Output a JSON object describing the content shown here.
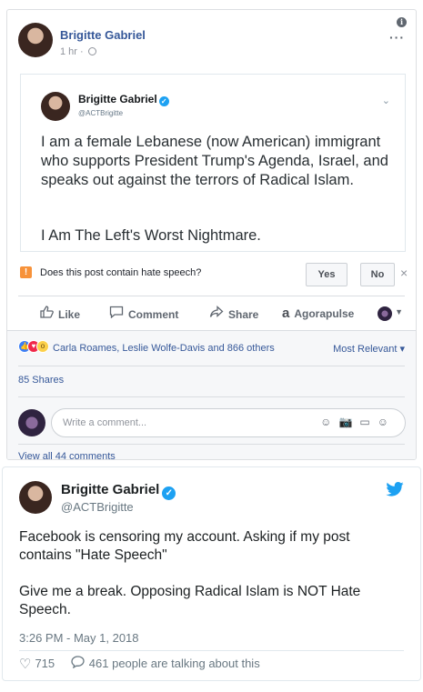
{
  "facebook": {
    "author": "Brigitte Gabriel",
    "time": "1 hr ·",
    "more_label": "···",
    "embedded_tweet": {
      "name": "Brigitte Gabriel",
      "handle": "@ACTBrigitte",
      "text": "I am a female Lebanese (now American) immigrant who supports President Trump's Agenda, Israel, and  speaks out against the terrors of Radical Islam.",
      "text2": "I Am The Left's Worst Nightmare."
    },
    "hate_prompt": {
      "question": "Does this post contain hate speech?",
      "yes": "Yes",
      "no": "No",
      "close": "×"
    },
    "actions": {
      "like": "Like",
      "comment": "Comment",
      "share": "Share",
      "agorapulse": "Agorapulse"
    },
    "reactions_names": "Carla Roames, Leslie Wolfe-Davis and 866 others",
    "most_relevant": "Most Relevant ▾",
    "shares": "85 Shares",
    "comment_placeholder": "Write a comment...",
    "view_all": "View all 44 comments"
  },
  "tweet": {
    "name": "Brigitte Gabriel",
    "handle": "@ACTBrigitte",
    "text1": "Facebook is censoring my account. Asking if my post contains \"Hate Speech\"",
    "text2": "Give me a break. Opposing Radical Islam is NOT Hate Speech.",
    "date": "3:26 PM - May 1, 2018",
    "likes": "715",
    "talking": "461 people are talking about this",
    "brand_color": "#1da1f2"
  }
}
